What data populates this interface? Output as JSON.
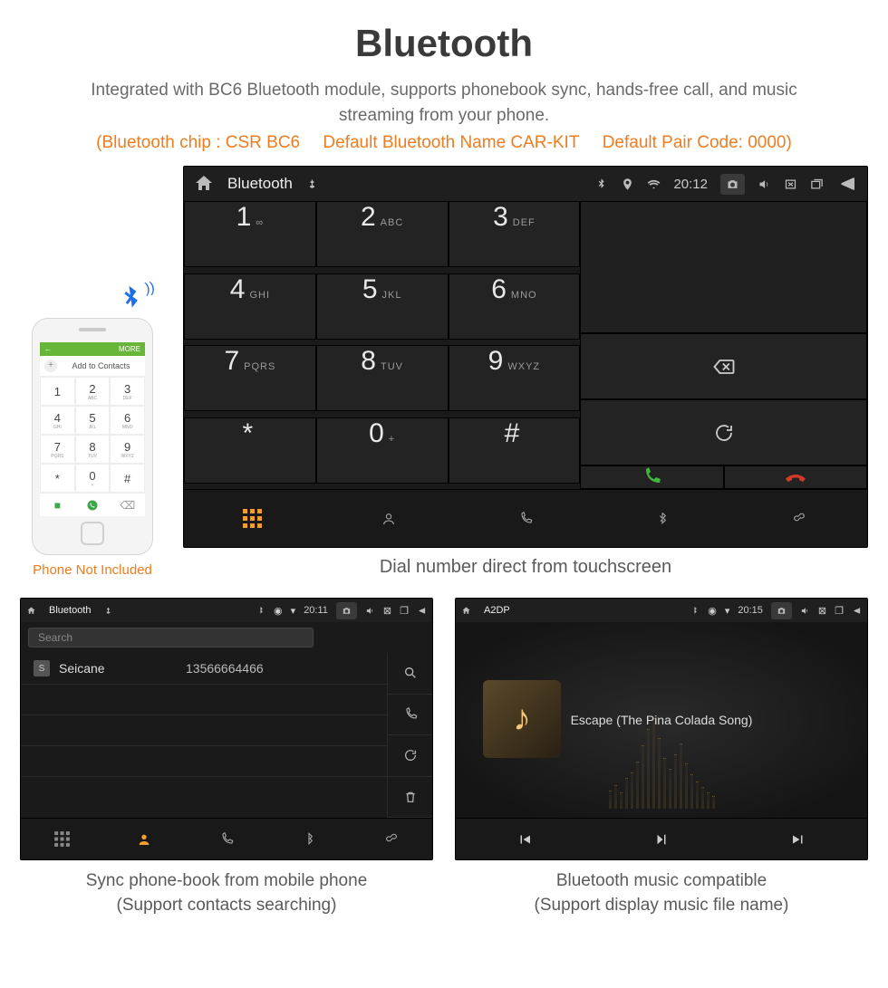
{
  "header": {
    "title": "Bluetooth",
    "subtitle": "Integrated with BC6 Bluetooth module, supports phonebook sync, hands-free call, and music streaming from your phone.",
    "spec_chip": "(Bluetooth chip : CSR BC6",
    "spec_name": "Default Bluetooth Name CAR-KIT",
    "spec_pair": "Default Pair Code: 0000)"
  },
  "phone": {
    "top_left": "←",
    "top_right": "MORE",
    "add_contact": "Add to Contacts",
    "caption": "Phone Not Included",
    "keys": [
      {
        "n": "1",
        "s": ""
      },
      {
        "n": "2",
        "s": "ABC"
      },
      {
        "n": "3",
        "s": "DEF"
      },
      {
        "n": "4",
        "s": "GHI"
      },
      {
        "n": "5",
        "s": "JKL"
      },
      {
        "n": "6",
        "s": "MNO"
      },
      {
        "n": "7",
        "s": "PQRS"
      },
      {
        "n": "8",
        "s": "TUV"
      },
      {
        "n": "9",
        "s": "WXYZ"
      },
      {
        "n": "*",
        "s": ""
      },
      {
        "n": "0",
        "s": "+"
      },
      {
        "n": "#",
        "s": ""
      }
    ]
  },
  "main_unit": {
    "status": {
      "title": "Bluetooth",
      "time": "20:12"
    },
    "keys": [
      {
        "n": "1",
        "s": "∞"
      },
      {
        "n": "2",
        "s": "ABC"
      },
      {
        "n": "3",
        "s": "DEF"
      },
      {
        "n": "4",
        "s": "GHI"
      },
      {
        "n": "5",
        "s": "JKL"
      },
      {
        "n": "6",
        "s": "MNO"
      },
      {
        "n": "7",
        "s": "PQRS"
      },
      {
        "n": "8",
        "s": "TUV"
      },
      {
        "n": "9",
        "s": "WXYZ"
      },
      {
        "n": "*",
        "s": ""
      },
      {
        "n": "0",
        "s": "+"
      },
      {
        "n": "#",
        "s": ""
      }
    ],
    "caption": "Dial number direct from touchscreen"
  },
  "contacts_panel": {
    "status": {
      "title": "Bluetooth",
      "time": "20:11"
    },
    "search_placeholder": "Search",
    "rows": [
      {
        "badge": "S",
        "name": "Seicane",
        "number": "13566664466"
      }
    ],
    "caption_l1": "Sync phone-book from mobile phone",
    "caption_l2": "(Support contacts searching)"
  },
  "a2dp_panel": {
    "status": {
      "title": "A2DP",
      "time": "20:15"
    },
    "song": "Escape (The Pina Colada Song)",
    "caption_l1": "Bluetooth music compatible",
    "caption_l2": "(Support display music file name)"
  }
}
